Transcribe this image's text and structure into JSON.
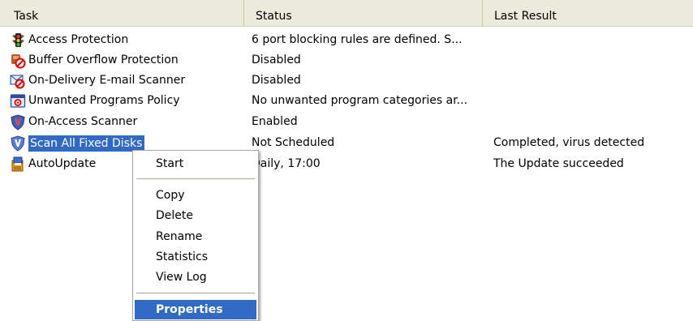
{
  "columns": {
    "task": "Task",
    "status": "Status",
    "last_result": "Last Result"
  },
  "rows": [
    {
      "icon": "traffic-light-icon",
      "task": "Access Protection",
      "status": "6 port blocking rules are defined.  S...",
      "last_result": ""
    },
    {
      "icon": "buffer-overflow-icon",
      "task": "Buffer Overflow Protection",
      "status": "Disabled",
      "last_result": ""
    },
    {
      "icon": "email-scanner-icon",
      "task": "On-Delivery E-mail Scanner",
      "status": "Disabled",
      "last_result": ""
    },
    {
      "icon": "unwanted-programs-icon",
      "task": "Unwanted Programs Policy",
      "status": "No unwanted program categories ar...",
      "last_result": ""
    },
    {
      "icon": "shield-icon",
      "task": "On-Access Scanner",
      "status": "Enabled",
      "last_result": ""
    },
    {
      "icon": "shield-icon",
      "task": "Scan All Fixed Disks",
      "status": "Not Scheduled",
      "last_result": "Completed, virus detected",
      "selected": true
    },
    {
      "icon": "autoupdate-icon",
      "task": "AutoUpdate",
      "status": "Daily, 17:00",
      "last_result": "The Update succeeded"
    }
  ],
  "context_menu": {
    "start": "Start",
    "copy": "Copy",
    "delete": "Delete",
    "rename": "Rename",
    "statistics": "Statistics",
    "view_log": "View Log",
    "properties": "Properties"
  },
  "colors": {
    "selection": "#316ac5",
    "header_bg": "#ebeadb"
  }
}
